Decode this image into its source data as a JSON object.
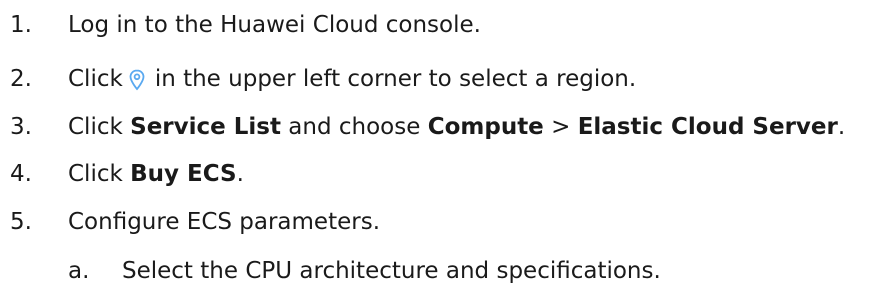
{
  "steps": [
    {
      "number": "1.",
      "text": "Log in to the Huawei Cloud console."
    },
    {
      "number": "2.",
      "before_icon": "Click",
      "icon": "location-pin-icon",
      "after_icon": "in the upper left corner to select a region."
    },
    {
      "number": "3.",
      "t1": "Click ",
      "b1": "Service List",
      "t2": " and choose ",
      "b2": "Compute",
      "t3": " > ",
      "b3": "Elastic Cloud Server",
      "t4": "."
    },
    {
      "number": "4.",
      "t1": "Click ",
      "b1": "Buy ECS",
      "t2": "."
    },
    {
      "number": "5.",
      "text": "Configure ECS parameters."
    }
  ],
  "substep": {
    "letter": "a.",
    "text": "Select the CPU architecture and specifications."
  },
  "colors": {
    "text": "#1a1a1a",
    "icon": "#5aa9f0"
  }
}
